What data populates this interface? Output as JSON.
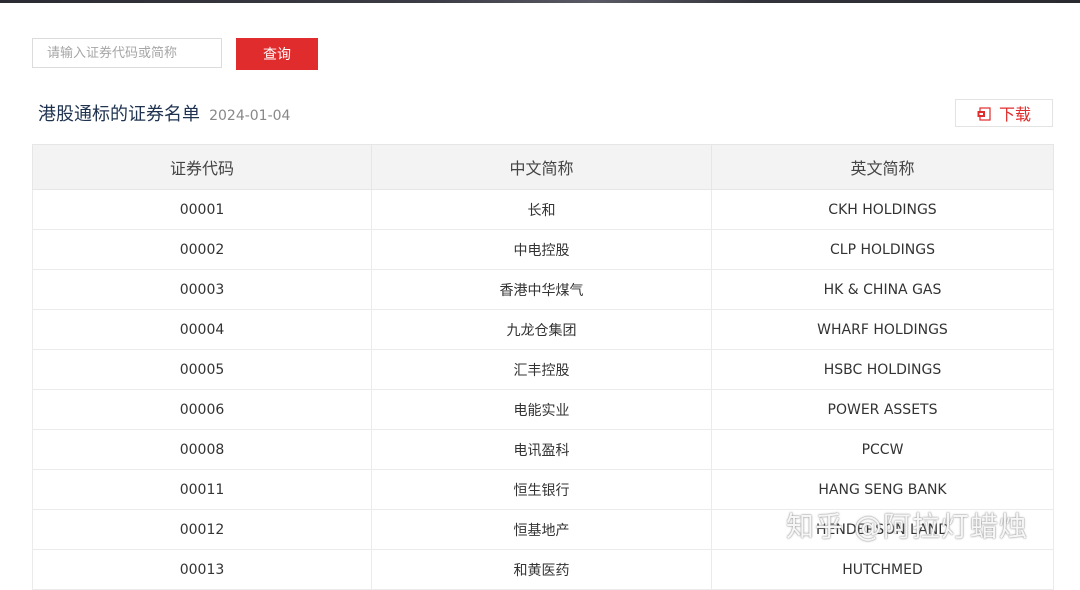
{
  "search": {
    "placeholder": "请输入证券代码或简称",
    "button_label": "查询"
  },
  "header": {
    "title": "港股通标的证券名单",
    "date": "2024-01-04",
    "download_label": "下载",
    "download_icon": "file-icon"
  },
  "table": {
    "columns": [
      "证券代码",
      "中文简称",
      "英文简称"
    ],
    "rows": [
      [
        "00001",
        "长和",
        "CKH HOLDINGS"
      ],
      [
        "00002",
        "中电控股",
        "CLP HOLDINGS"
      ],
      [
        "00003",
        "香港中华煤气",
        "HK & CHINA GAS"
      ],
      [
        "00004",
        "九龙仓集团",
        "WHARF HOLDINGS"
      ],
      [
        "00005",
        "汇丰控股",
        "HSBC HOLDINGS"
      ],
      [
        "00006",
        "电能实业",
        "POWER ASSETS"
      ],
      [
        "00008",
        "电讯盈科",
        "PCCW"
      ],
      [
        "00011",
        "恒生银行",
        "HANG SENG BANK"
      ],
      [
        "00012",
        "恒基地产",
        "HENDERSON LAND"
      ],
      [
        "00013",
        "和黄医药",
        "HUTCHMED"
      ]
    ]
  },
  "watermark": "知乎 @阿拉灯蜡烛",
  "colors": {
    "accent": "#e02c2c",
    "title": "#1f3350",
    "header_bg": "#f3f3f3"
  }
}
